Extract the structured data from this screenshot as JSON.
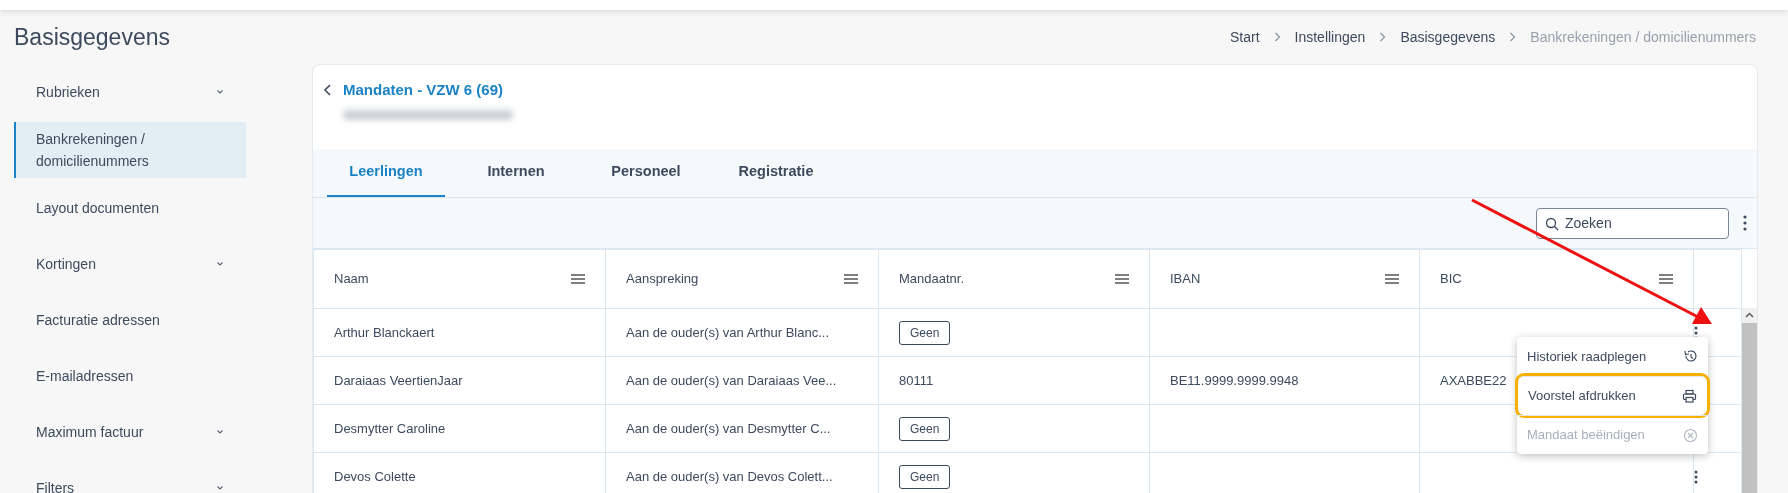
{
  "page_title": "Basisgegevens",
  "breadcrumb": [
    {
      "label": "Start",
      "current": false
    },
    {
      "label": "Instellingen",
      "current": false
    },
    {
      "label": "Basisgegevens",
      "current": false
    },
    {
      "label": "Bankrekeningen / domicilienummers",
      "current": true
    }
  ],
  "sidebar": {
    "items": [
      {
        "label": "Rubrieken",
        "expandable": true,
        "selected": false
      },
      {
        "label": "Bankrekeningen / domicilienummers",
        "expandable": false,
        "selected": true
      },
      {
        "label": "Layout documenten",
        "expandable": false,
        "selected": false
      },
      {
        "label": "Kortingen",
        "expandable": true,
        "selected": false
      },
      {
        "label": "Facturatie adressen",
        "expandable": false,
        "selected": false
      },
      {
        "label": "E-mailadressen",
        "expandable": false,
        "selected": false
      },
      {
        "label": "Maximum factuur",
        "expandable": true,
        "selected": false
      },
      {
        "label": "Filters",
        "expandable": true,
        "selected": false
      }
    ]
  },
  "card": {
    "title": "Mandaten - VZW 6 (69)",
    "tabs": [
      {
        "label": "Leerlingen",
        "selected": true
      },
      {
        "label": "Internen",
        "selected": false
      },
      {
        "label": "Personeel",
        "selected": false
      },
      {
        "label": "Registratie",
        "selected": false
      }
    ],
    "search": {
      "placeholder": "Zoeken"
    },
    "table": {
      "columns": [
        "Naam",
        "Aanspreking",
        "Mandaatnr.",
        "IBAN",
        "BIC"
      ],
      "rows": [
        {
          "naam": "Arthur Blanckaert",
          "aanspreking": "Aan de ouder(s) van Arthur Blanc...",
          "mandaatnr": {
            "text": "Geen",
            "kind": "badge"
          }
        },
        {
          "naam": "Daraiaas VeertienJaar",
          "aanspreking": "Aan de ouder(s) van Daraiaas Vee...",
          "mandaatnr": {
            "text": "80111",
            "kind": "plain"
          },
          "iban": "BE11.9999.9999.9948",
          "bic": "AXABBE22"
        },
        {
          "naam": "Desmytter Caroline",
          "aanspreking": "Aan de ouder(s) van Desmytter C...",
          "mandaatnr": {
            "text": "Geen",
            "kind": "badge"
          }
        },
        {
          "naam": "Devos Colette",
          "aanspreking": "Aan de ouder(s) van Devos Colett...",
          "mandaatnr": {
            "text": "Geen",
            "kind": "badge"
          }
        }
      ]
    },
    "context_menu": {
      "items": [
        {
          "label": "Historiek raadplegen",
          "kind": "history",
          "disabled": false,
          "highlighted": false
        },
        {
          "label": "Voorstel afdrukken",
          "kind": "print",
          "disabled": false,
          "highlighted": true
        },
        {
          "label": "Mandaat beëindigen",
          "kind": "end",
          "disabled": true,
          "highlighted": false
        }
      ]
    }
  }
}
